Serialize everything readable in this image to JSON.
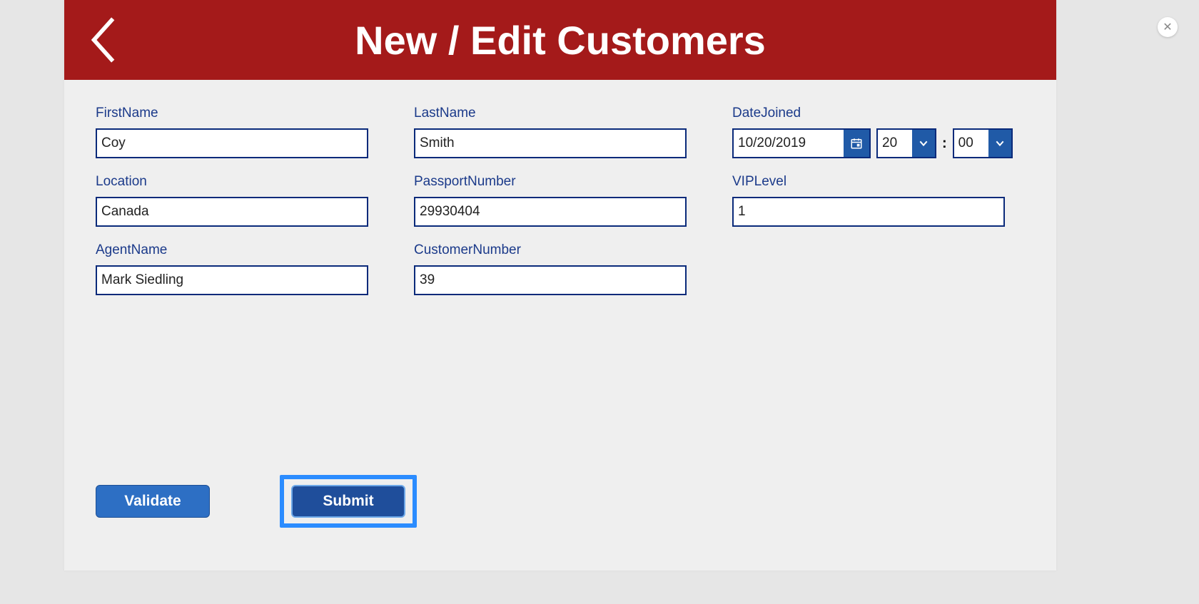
{
  "header": {
    "title": "New / Edit Customers"
  },
  "form": {
    "firstName": {
      "label": "FirstName",
      "value": "Coy"
    },
    "lastName": {
      "label": "LastName",
      "value": "Smith"
    },
    "dateJoined": {
      "label": "DateJoined",
      "date": "10/20/2019",
      "hour": "20",
      "minute": "00",
      "timeSeparator": ":"
    },
    "location": {
      "label": "Location",
      "value": "Canada"
    },
    "passportNumber": {
      "label": "PassportNumber",
      "value": "29930404"
    },
    "vipLevel": {
      "label": "VIPLevel",
      "value": "1"
    },
    "agentName": {
      "label": "AgentName",
      "value": "Mark Siedling"
    },
    "customerNumber": {
      "label": "CustomerNumber",
      "value": "39"
    }
  },
  "buttons": {
    "validate": "Validate",
    "submit": "Submit"
  }
}
